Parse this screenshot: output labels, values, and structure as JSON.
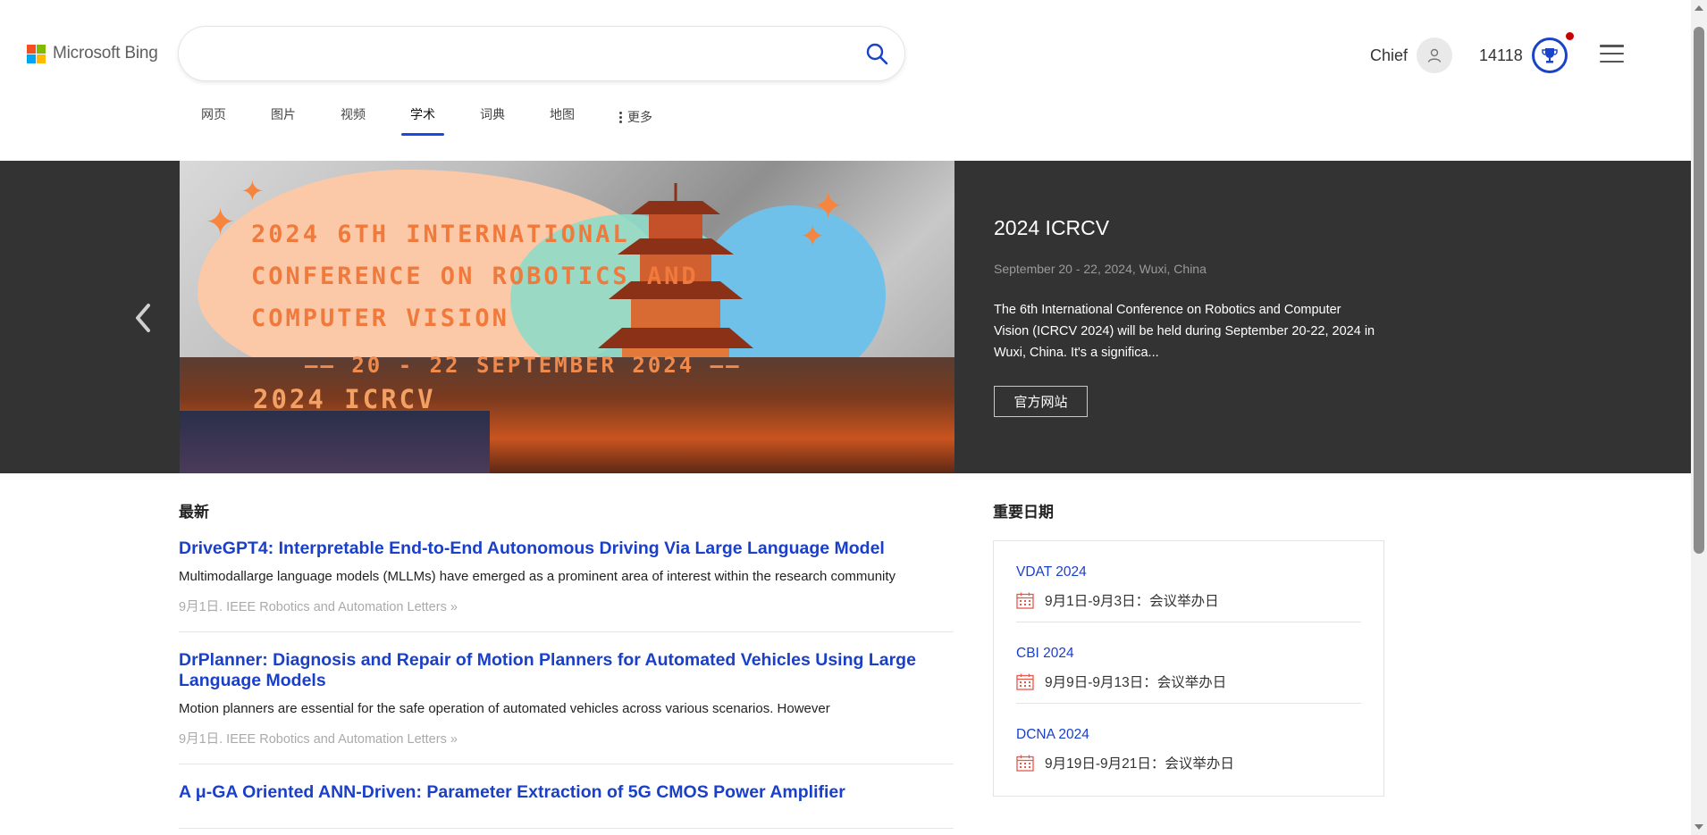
{
  "header": {
    "logo_text": "Microsoft Bing",
    "search": {
      "value": "",
      "placeholder": ""
    },
    "user_name": "Chief",
    "points": "14118"
  },
  "tabs": [
    {
      "label": "网页"
    },
    {
      "label": "图片"
    },
    {
      "label": "视频"
    },
    {
      "label": "学术",
      "active": true
    },
    {
      "label": "词典"
    },
    {
      "label": "地图"
    },
    {
      "label": "更多"
    }
  ],
  "hero": {
    "banner_lines": [
      "2024 6TH INTERNATIONAL",
      "CONFERENCE ON ROBOTICS AND",
      "COMPUTER VISION",
      "—— 20 - 22 SEPTEMBER 2024 ——",
      "2024 ICRCV"
    ],
    "title": "2024 ICRCV",
    "date": "September 20 - 22, 2024, Wuxi, China",
    "description": "The 6th International Conference on Robotics and Computer Vision (ICRCV 2024) will be held during September 20-22, 2024 in Wuxi, China. It's a significa...",
    "button_label": "官方网站"
  },
  "latest": {
    "title": "最新",
    "articles": [
      {
        "title": "DriveGPT4: Interpretable End-to-End Autonomous Driving Via Large Language Model",
        "snippet": "Multimodallarge language models (MLLMs) have emerged as a prominent area of interest within the research community",
        "meta": "9月1日. IEEE Robotics and Automation Letters »"
      },
      {
        "title": "DrPlanner: Diagnosis and Repair of Motion Planners for Automated Vehicles Using Large Language Models",
        "snippet": "Motion planners are essential for the safe operation of automated vehicles across various scenarios. However",
        "meta": "9月1日. IEEE Robotics and Automation Letters »"
      },
      {
        "title": "A μ-GA Oriented ANN-Driven: Parameter Extraction of 5G CMOS Power Amplifier",
        "snippet": "",
        "meta": ""
      }
    ]
  },
  "important_dates": {
    "title": "重要日期",
    "items": [
      {
        "name": "VDAT 2024",
        "date": "9月1日-9月3日：会议举办日"
      },
      {
        "name": "CBI 2024",
        "date": "9月9日-9月13日：会议举办日"
      },
      {
        "name": "DCNA 2024",
        "date": "9月19日-9月21日：会议举办日"
      }
    ]
  },
  "colors": {
    "accent": "#174ae4",
    "link": "#1a3fc9",
    "hero_bg": "#333333",
    "calendar_icon": "#e8584a",
    "notification": "#c80000"
  },
  "icons": [
    "search-icon",
    "user-icon",
    "trophy-icon",
    "menu-icon",
    "more-icon",
    "chevron-left-icon",
    "calendar-icon"
  ]
}
